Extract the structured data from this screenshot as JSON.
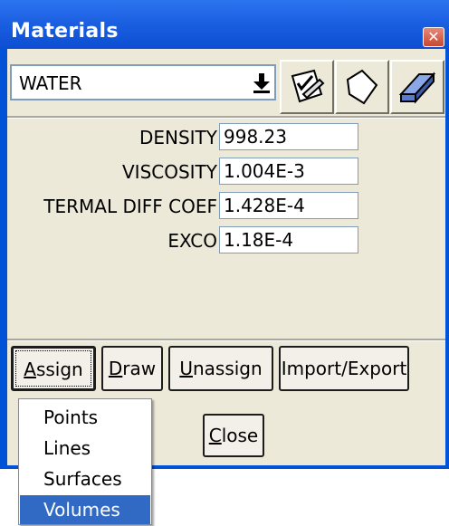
{
  "window": {
    "title": "Materials",
    "close_glyph": "✕"
  },
  "material": {
    "selected": "WATER",
    "dropdown_arrow": "⭳"
  },
  "toolbar": {
    "icons": [
      "edit-material-icon",
      "new-material-icon",
      "erase-material-icon"
    ]
  },
  "properties": [
    {
      "label": "DENSITY",
      "value": "998.23"
    },
    {
      "label": "VISCOSITY",
      "value": "1.004E-3"
    },
    {
      "label": "TERMAL DIFF COEF",
      "value": "1.428E-4"
    },
    {
      "label": "EXCO",
      "value": "1.18E-4"
    }
  ],
  "buttons": {
    "assign": {
      "mnemonic": "A",
      "rest": "ssign"
    },
    "draw": {
      "mnemonic": "D",
      "rest": "raw"
    },
    "unassign": {
      "mnemonic": "U",
      "rest": "nassign"
    },
    "import_export": "Import/Export",
    "close": {
      "mnemonic": "C",
      "rest": "lose"
    }
  },
  "assign_menu": {
    "items": [
      "Points",
      "Lines",
      "Surfaces",
      "Volumes"
    ],
    "highlighted": "Volumes"
  },
  "colors": {
    "titlebar": "#0d4ed2",
    "client": "#ece9d8",
    "menu_highlight": "#316ac5"
  }
}
